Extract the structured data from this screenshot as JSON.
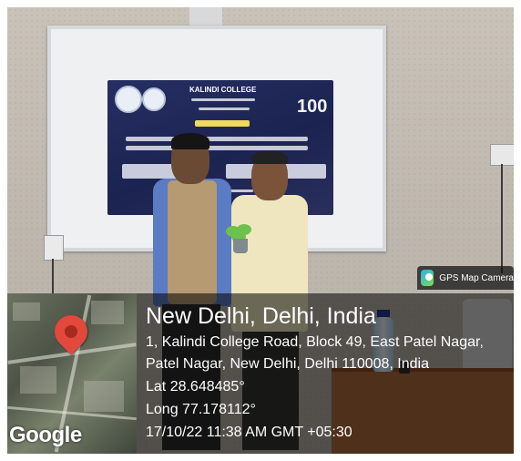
{
  "badge": {
    "icon": "gps-map-camera-icon",
    "label": "GPS Map Camera"
  },
  "map": {
    "watermark": "Google",
    "pin_color": "#e2483b"
  },
  "location": {
    "title": "New Delhi, Delhi, India",
    "address_line1": "1, Kalindi College Road, Block 49, East Patel Nagar,",
    "address_line2": "Patel Nagar, New Delhi, Delhi 110008, India",
    "latitude": "Lat 28.648485°",
    "longitude": "Long 77.178112°",
    "timestamp": "17/10/22 11:38 AM GMT +05:30"
  },
  "projection": {
    "college": "KALINDI COLLEGE",
    "anniversary": "100"
  }
}
